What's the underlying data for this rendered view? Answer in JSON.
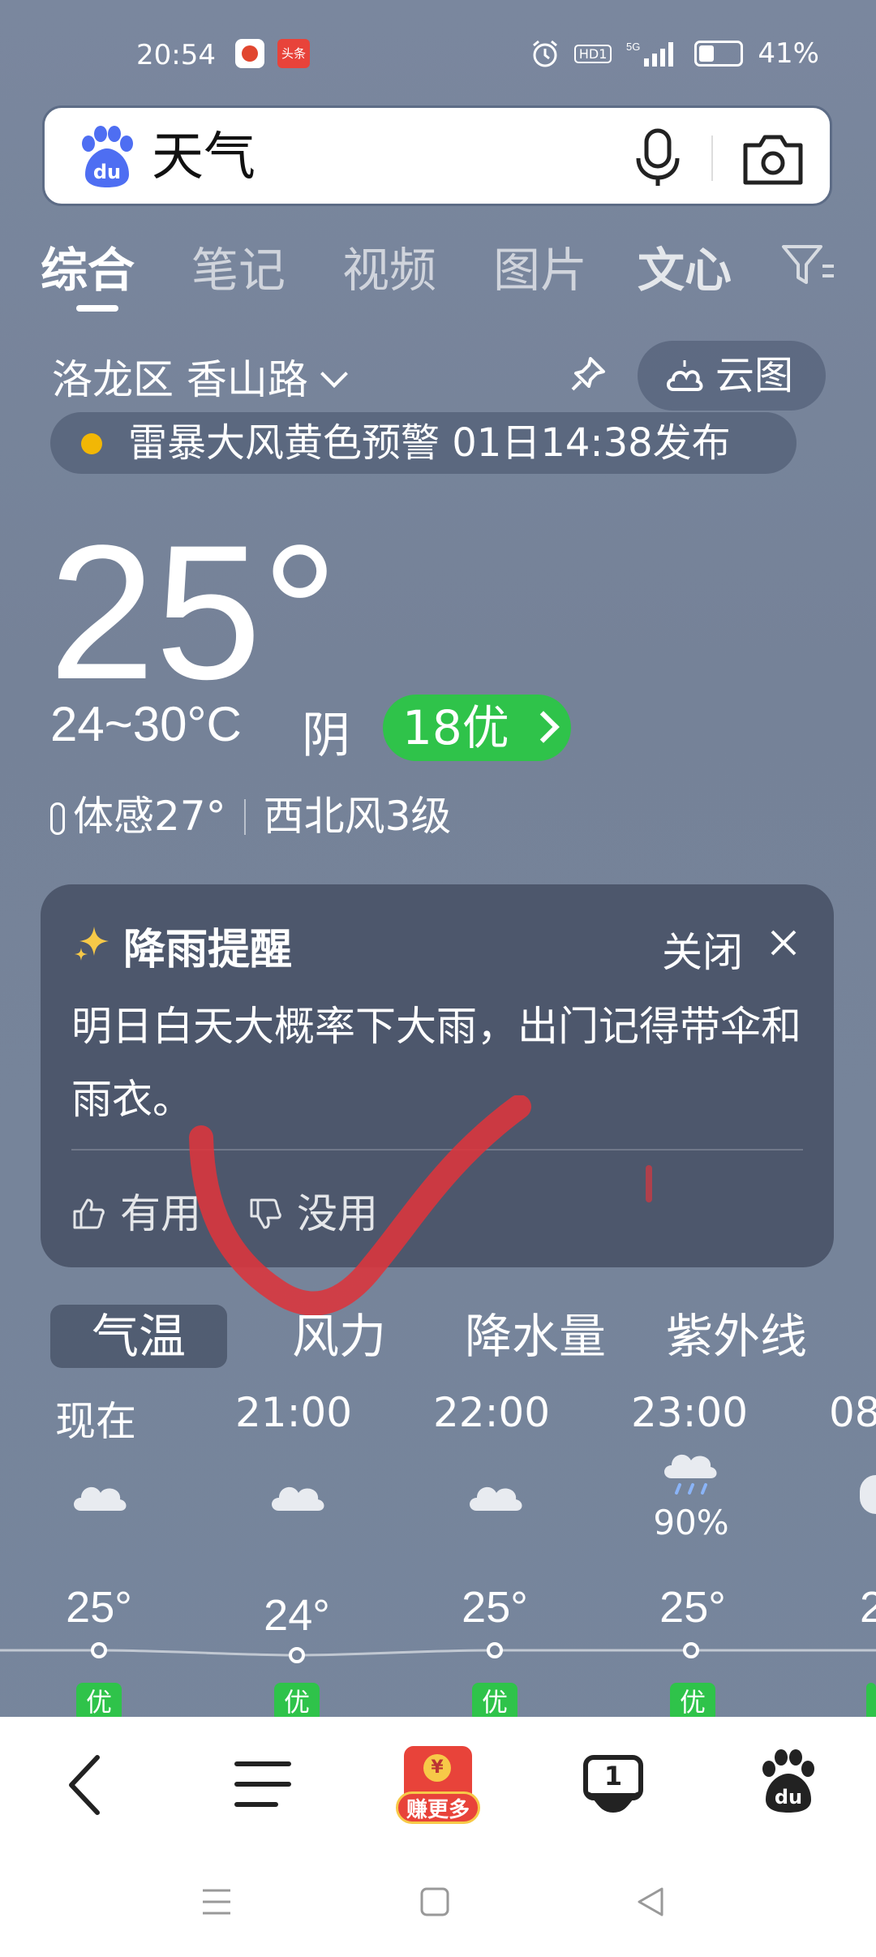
{
  "status_bar": {
    "time": "20:54",
    "app2": "头条",
    "hd": "HD1",
    "net": "5G",
    "battery": "41%"
  },
  "search": {
    "query": "天气"
  },
  "tabs": [
    "综合",
    "笔记",
    "视频",
    "图片",
    "文心"
  ],
  "location": {
    "name": "洛龙区 香山路",
    "cloud_map": "云图"
  },
  "alert": {
    "text": "雷暴大风黄色预警 01日14:38发布",
    "color": "#f2b705"
  },
  "current": {
    "temp": "25°",
    "range": "24~30°C",
    "condition": "阴",
    "aqi": "18优",
    "feels_like": "体感27°",
    "wind": "西北风3级"
  },
  "rain_card": {
    "title": "降雨提醒",
    "close": "关闭",
    "body": "明日白天大概率下大雨，出门记得带伞和雨衣。",
    "useful": "有用",
    "useless": "没用"
  },
  "hourly_tabs": [
    "气温",
    "风力",
    "降水量",
    "紫外线"
  ],
  "hourly": [
    {
      "time": "现在",
      "icon": "cloudy-icon",
      "precip": "",
      "temp": "25°",
      "aq": "优"
    },
    {
      "time": "21:00",
      "icon": "cloudy-icon",
      "precip": "",
      "temp": "24°",
      "aq": "优"
    },
    {
      "time": "22:00",
      "icon": "cloudy-icon",
      "precip": "",
      "temp": "25°",
      "aq": "优"
    },
    {
      "time": "23:00",
      "icon": "rain-icon",
      "precip": "90%",
      "temp": "25°",
      "aq": "优"
    },
    {
      "time": "08",
      "icon": "cloudy-icon",
      "precip": "",
      "temp": "2",
      "aq": ""
    }
  ],
  "bottom_nav": {
    "earn_more": "赚更多",
    "earn_badge": "¥",
    "tab_count": "1"
  },
  "colors": {
    "accent_green": "#2fc34a",
    "earn_red": "#e8433a"
  }
}
